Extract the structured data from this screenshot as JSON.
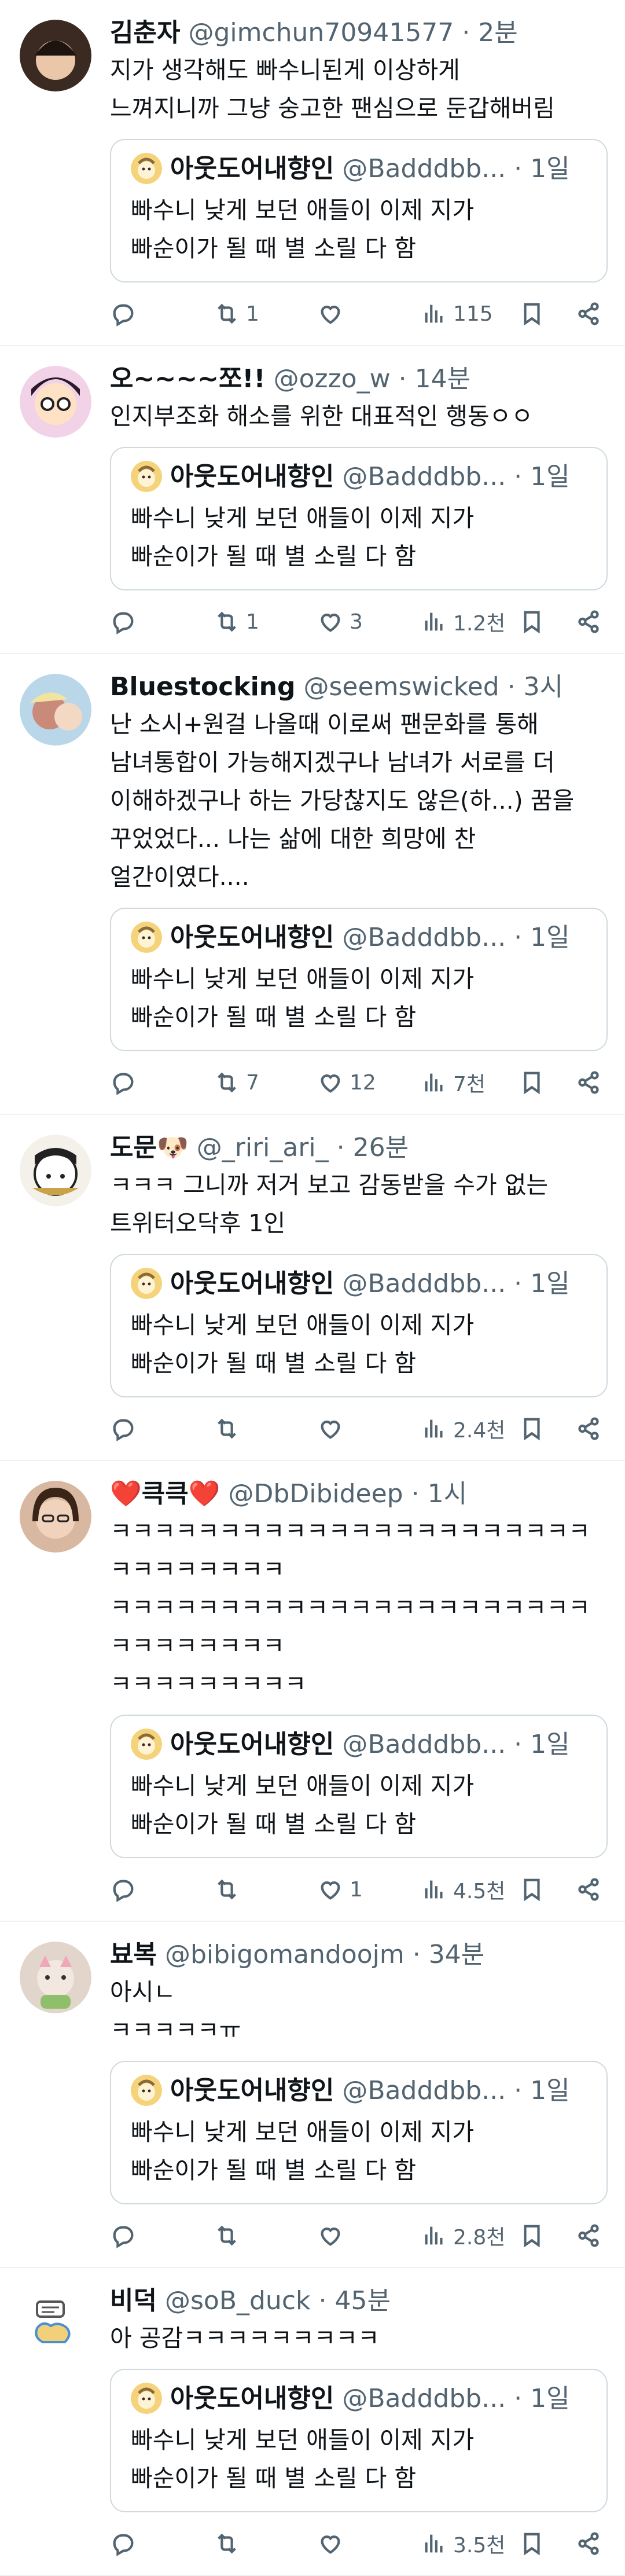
{
  "quoted": {
    "name": "아웃도어내향인",
    "handle": "@Badddbb...",
    "dot": "·",
    "time": "1일",
    "text": "빠수니 낮게 보던 애들이 이제 지가\n빠순이가 될 때 별 소릴 다 함"
  },
  "tweets": [
    {
      "name": "김춘자",
      "handle": "@gimchun70941577",
      "dot": "·",
      "time": "2분",
      "text": "지가 생각해도 빠수니된게 이상하게\n느껴지니까 그냥 숭고한 팬심으로 둔갑해버림",
      "replies": "",
      "retweets": "1",
      "likes": "",
      "views": "115",
      "avatar_color": "#3a2a22"
    },
    {
      "name": "오~~~~쪼!!",
      "handle": "@ozzo_w",
      "dot": "·",
      "time": "14분",
      "text": "인지부조화 해소를 위한 대표적인 행동ㅇㅇ",
      "replies": "",
      "retweets": "1",
      "likes": "3",
      "views": "1.2천",
      "avatar_color": "#d86aa8"
    },
    {
      "name": "Bluestocking",
      "handle": "@seemswicked",
      "dot": "·",
      "time": "3시",
      "text": "난 소시+원걸 나올때 이로써 팬문화를 통해\n남녀통합이 가능해지겠구나 남녀가 서로를 더\n이해하겠구나 하는 가당찮지도 않은(하...) 꿈을\n꾸었었다... 나는 삶에 대한 희망에 찬\n얼간이였다....",
      "replies": "",
      "retweets": "7",
      "likes": "12",
      "views": "7천",
      "avatar_color": "#c98a7a"
    },
    {
      "name": "도문🐶",
      "handle": "@_riri_ari_",
      "dot": "·",
      "time": "26분",
      "text": "ㅋㅋㅋ 그니까 저거 보고 감동받을 수가 없는\n트위터오닥후 1인",
      "replies": "",
      "retweets": "",
      "likes": "",
      "views": "2.4천",
      "avatar_color": "#e8e6e0"
    },
    {
      "name": "❤️큭큭❤️",
      "handle": "@DbDibideep",
      "dot": "·",
      "time": "1시",
      "text": "ㅋㅋㅋㅋㅋㅋㅋㅋㅋㅋㅋㅋㅋㅋㅋㅋㅋㅋㅋㅋㅋㅋㅋㅋㅋㅋㅋㅋㅋㅋ\nㅋㅋㅋㅋㅋㅋㅋㅋㅋㅋㅋㅋㅋㅋㅋㅋㅋㅋㅋㅋㅋㅋㅋㅋㅋㅋㅋㅋㅋㅋ\nㅋㅋㅋㅋㅋㅋㅋㅋㅋ",
      "replies": "",
      "retweets": "",
      "likes": "1",
      "views": "4.5천",
      "avatar_color": "#b8876a"
    },
    {
      "name": "뵤복",
      "handle": "@bibigomandoojm",
      "dot": "·",
      "time": "34분",
      "text": "아시ㄴ\nㅋㅋㅋㅋㅋㅠ",
      "replies": "",
      "retweets": "",
      "likes": "",
      "views": "2.8천",
      "avatar_color": "#c9b7a8"
    },
    {
      "name": "비덕",
      "handle": "@soB_duck",
      "dot": "·",
      "time": "45분",
      "text": "아 공감ㅋㅋㅋㅋㅋㅋㅋㅋㅋ",
      "replies": "",
      "retweets": "",
      "likes": "",
      "views": "3.5천",
      "avatar_color": "#ffffff"
    }
  ],
  "colors": {
    "accent": "#1d9bf0",
    "muted": "#536471",
    "border": "#cfd9de",
    "divider": "#eff3f4"
  }
}
